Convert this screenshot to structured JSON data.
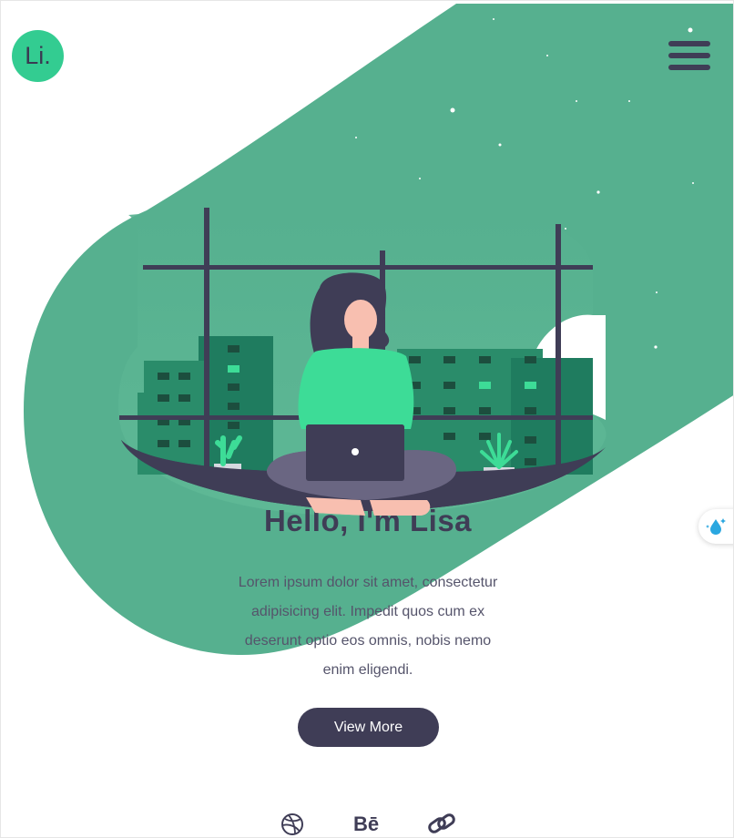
{
  "header": {
    "logo_text": "Li.",
    "menu_icon": "hamburger-icon"
  },
  "hero": {
    "title": "Hello, I'm Lisa",
    "description": "Lorem ipsum dolor sit amet, consectetur adipisicing elit. Impedit quos cum ex deserunt optio eos omnis, nobis nemo enim eligendi.",
    "cta_label": "View More"
  },
  "social": {
    "dribbble_icon": "dribbble-icon",
    "behance_label": "Bē",
    "link_icon": "link-icon"
  },
  "side_widget": {
    "icon": "water-drop-sparkle-icon"
  },
  "colors": {
    "accent": "#33cc91",
    "blob": "#56b08f",
    "dark": "#3f3d56",
    "text": "#55546b"
  }
}
